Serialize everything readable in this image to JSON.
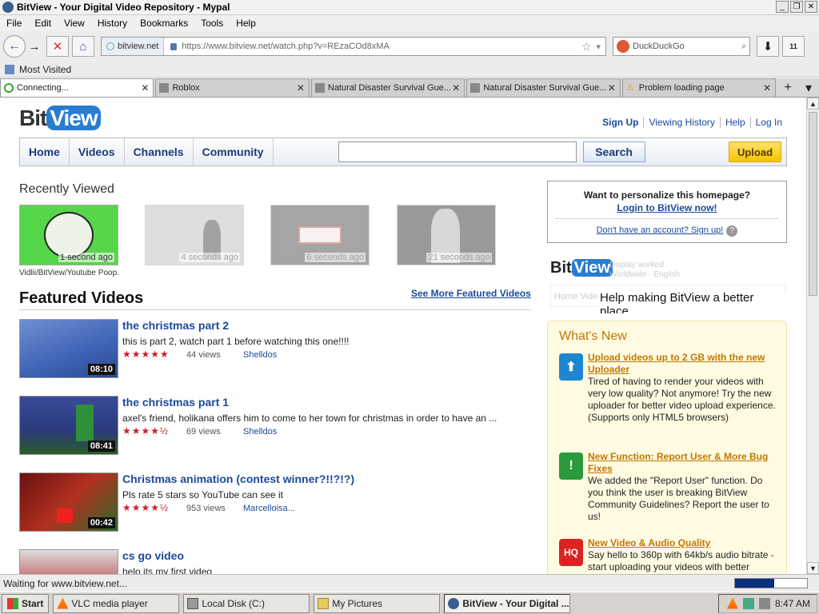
{
  "window": {
    "title": "BitView - Your Digital Video Repository - Mypal",
    "controls": [
      "_",
      "❐",
      "✕"
    ]
  },
  "menu": [
    "File",
    "Edit",
    "View",
    "History",
    "Bookmarks",
    "Tools",
    "Help"
  ],
  "navbar": {
    "site_label": "bitview.net",
    "url": "https://www.bitview.net/watch.php?v=REzaCOd8xMA",
    "search_placeholder": "DuckDuckGo",
    "badge": "11"
  },
  "bookmarks": {
    "most_visited": "Most Visited"
  },
  "tabs": [
    {
      "label": "Connecting...",
      "active": true
    },
    {
      "label": "Roblox",
      "active": false
    },
    {
      "label": "Natural Disaster Survival Gue...",
      "active": false
    },
    {
      "label": "Natural Disaster Survival Gue...",
      "active": false
    },
    {
      "label": "Problem loading page",
      "active": false
    }
  ],
  "page": {
    "logo": {
      "bit": "Bit",
      "view": "View"
    },
    "toplinks": [
      "Sign Up",
      "Viewing History",
      "Help",
      "Log In"
    ],
    "nav": [
      "Home",
      "Videos",
      "Channels",
      "Community"
    ],
    "search_button": "Search",
    "upload_button": "Upload",
    "recently_viewed_title": "Recently Viewed",
    "recent": [
      {
        "time": "1 second ago",
        "caption": "Vidlii/BitView/Youtube Poop..."
      },
      {
        "time": "4 seconds ago",
        "caption": ""
      },
      {
        "time": "6 seconds ago",
        "caption": ""
      },
      {
        "time": "21 seconds ago",
        "caption": ""
      }
    ],
    "featured_title": "Featured Videos",
    "see_more": "See More Featured Videos",
    "videos": [
      {
        "title": "the christmas part 2",
        "desc": "this is part 2, watch part 1 before watching this one!!!!",
        "stars": "★★★★★",
        "views": "44 views",
        "author": "Shelldos",
        "duration": "08:10"
      },
      {
        "title": "the christmas part 1",
        "desc": "axel's friend, holikana offers him to come to her town for christmas in order to have an ...",
        "stars": "★★★★½",
        "views": "69 views",
        "author": "Shelldos",
        "duration": "08:41"
      },
      {
        "title": "Christmas animation (contest winner?!!?!?)",
        "desc": "Pls rate 5 stars so YouTube can see it",
        "stars": "★★★★½",
        "views": "953 views",
        "author": "Marcelloisa...",
        "duration": "00:42"
      },
      {
        "title": "cs go video",
        "desc": "helo its my first video",
        "stars": "",
        "views": "",
        "author": "",
        "duration": ""
      }
    ],
    "personalize": {
      "question": "Want to personalize this homepage?",
      "login": "Login to BitView now!",
      "signup": "Don't have an account? Sign up!"
    },
    "promo": {
      "help_text": "Help making BitView a better place.",
      "faint1": "Display worked",
      "faint2": "Worldwide · English",
      "ghost_nav": "Home    Videos    Channels    Community"
    },
    "whats_new": {
      "title": "What's New",
      "items": [
        {
          "icon": "upload-icon",
          "title": "Upload videos up to 2 GB with the new Uploader",
          "body": "Tired of having to render your videos with very low quality? Not anymore! Try the new uploader for better video upload experience. (Supports only HTML5 browsers)"
        },
        {
          "icon": "warning-icon",
          "title": "New Function: Report User & More Bug Fixes",
          "body": "We added the \"Report User\" function. Do you think the user is breaking BitView Community Guidelines? Report the user to us!"
        },
        {
          "icon": "hq-icon",
          "title": "New Video & Audio Quality",
          "body": "Say hello to 360p with 64kb/s audio bitrate - start uploading your videos with better"
        }
      ]
    }
  },
  "status": {
    "text": "Waiting for www.bitview.net...",
    "progress": 0.54
  },
  "taskbar": {
    "start": "Start",
    "tasks": [
      {
        "label": "VLC media player",
        "active": false
      },
      {
        "label": "Local Disk (C:)",
        "active": false
      },
      {
        "label": "My Pictures",
        "active": false
      },
      {
        "label": "BitView - Your Digital ...",
        "active": true
      }
    ],
    "clock": "8:47 AM"
  },
  "colors": {
    "link": "#1a4a9a",
    "accent_gold": "#c07800",
    "star_red": "#c8202a"
  }
}
